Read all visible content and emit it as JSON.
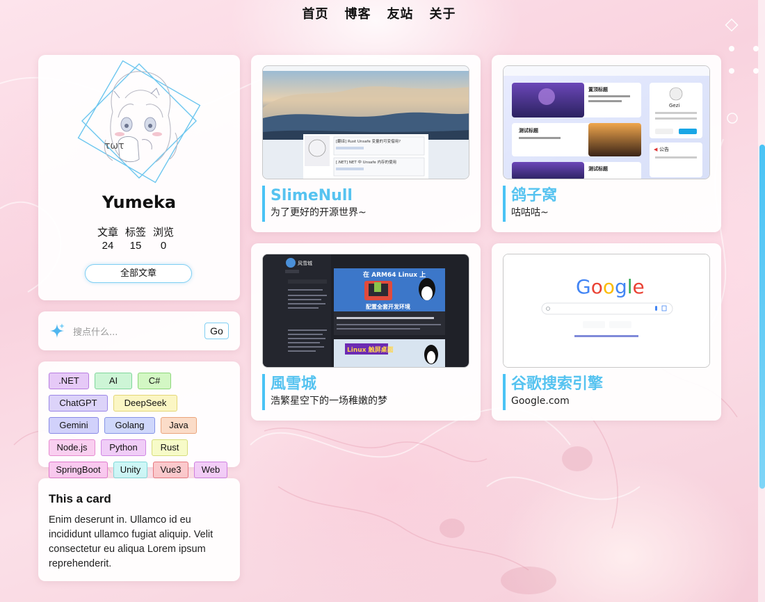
{
  "nav": {
    "items": [
      {
        "label": "首页"
      },
      {
        "label": "博客"
      },
      {
        "label": "友站"
      },
      {
        "label": "关于"
      }
    ]
  },
  "profile": {
    "name": "Yumeka",
    "stats": [
      {
        "label": "文章",
        "value": "24"
      },
      {
        "label": "标签",
        "value": "15"
      },
      {
        "label": "浏览",
        "value": "0"
      }
    ],
    "all_posts_label": "全部文章"
  },
  "search": {
    "placeholder": "搜点什么...",
    "button_label": "Go"
  },
  "tags": [
    {
      "label": ".NET",
      "bg": "#e6c9f7",
      "border": "#b87de0"
    },
    {
      "label": "AI",
      "bg": "#cdf5d6",
      "border": "#7fd69a"
    },
    {
      "label": "C#",
      "bg": "#d3f7c4",
      "border": "#8cd67a"
    },
    {
      "label": "ChatGPT",
      "bg": "#dcd3f9",
      "border": "#9b86e6"
    },
    {
      "label": "DeepSeek",
      "bg": "#fbf6c4",
      "border": "#e3d676"
    },
    {
      "label": "Gemini",
      "bg": "#d1d1fb",
      "border": "#8a8ae6"
    },
    {
      "label": "Golang",
      "bg": "#cfd7fb",
      "border": "#8593e6"
    },
    {
      "label": "Java",
      "bg": "#fbdcc8",
      "border": "#eaa57d"
    },
    {
      "label": "Node.js",
      "bg": "#f9cff0",
      "border": "#e68ad0"
    },
    {
      "label": "Python",
      "bg": "#f0cdf7",
      "border": "#cf86e3"
    },
    {
      "label": "Rust",
      "bg": "#f7fbc8",
      "border": "#d6dc7a"
    },
    {
      "label": "SpringBoot",
      "bg": "#f9c9ef",
      "border": "#e07acd"
    },
    {
      "label": "Unity",
      "bg": "#cdf6f6",
      "border": "#7fd9d9"
    },
    {
      "label": "Vue3",
      "bg": "#fbc9cc",
      "border": "#e6787f"
    },
    {
      "label": "Web",
      "bg": "#f2cdf7",
      "border": "#cf7fe0"
    }
  ],
  "note_card": {
    "title": "This a card",
    "body": "Enim deserunt in. Ullamco id eu incididunt ullamco fugiat aliquip. Velit consectetur eu aliqua Lorem ipsum reprehenderit."
  },
  "friends": [
    {
      "name": "SlimeNull",
      "desc": "为了更好的开源世界~",
      "shot_texts": [
        "[翻译] Rust Unsafe 变量的可变借用?",
        "[.NET] NET 中 Unsafe 内存的使用"
      ]
    },
    {
      "name": "鸽子窝",
      "desc": "咕咕咕~",
      "shot_texts": [
        "置顶标题",
        "测试标题",
        "测试标题",
        "公告",
        "Gezi"
      ]
    },
    {
      "name": "風雪城",
      "desc": "浩繁星空下的一场稚嫩的梦",
      "shot_texts": [
        "风雪城",
        "在 ARM64 Linux 上",
        "配置全套开发环境",
        "Linux 触屏桌面"
      ]
    },
    {
      "name": "谷歌搜索引擎",
      "desc": "Google.com",
      "shot_texts": [
        "Google"
      ]
    }
  ],
  "colors": {
    "accent": "#56c3f0",
    "scrollbar": "#4ac3f5"
  }
}
